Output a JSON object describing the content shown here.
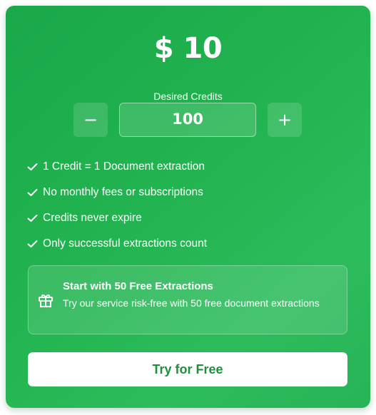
{
  "pricing": {
    "price": "$ 10",
    "credits_label": "Desired Credits",
    "decrement_symbol": "−",
    "increment_symbol": "+",
    "credits_value": "100"
  },
  "features": [
    {
      "icon": "check-icon",
      "text": "1 Credit = 1 Document extraction"
    },
    {
      "icon": "check-icon",
      "text": "No monthly fees or subscriptions"
    },
    {
      "icon": "check-icon",
      "text": "Credits never expire"
    },
    {
      "icon": "check-icon",
      "text": "Only successful extractions count"
    }
  ],
  "promo": {
    "icon": "gift-icon",
    "title": "Start with 50 Free Extractions",
    "description": "Try our service risk-free with 50 free document extractions"
  },
  "cta": {
    "label": "Try for Free"
  },
  "colors": {
    "card_green": "#22b450",
    "cta_text": "#1f8f3e",
    "text": "#ffffff"
  }
}
